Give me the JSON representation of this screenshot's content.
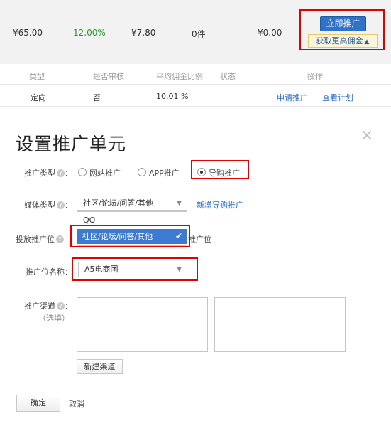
{
  "product_row": {
    "price": "¥65.00",
    "rate": "12.00%",
    "commission": "¥7.80",
    "count": "0件",
    "total": "¥0.00",
    "promote_button": "立即推广",
    "more_commission_button": "获取更高佣金"
  },
  "plan_table": {
    "headers": [
      "类型",
      "是否审核",
      "平均佣金比例",
      "状态",
      "操作"
    ],
    "row": {
      "type": "定向",
      "review": "否",
      "avg_rate": "10.01 %",
      "actions": [
        "申请推广",
        "查看计划"
      ]
    }
  },
  "dialog": {
    "title": "设置推广单元",
    "close_icon": "×",
    "promo_type": {
      "label": "推广类型",
      "options": [
        "网站推广",
        "APP推广",
        "导购推广"
      ],
      "selected": "导购推广"
    },
    "media_type": {
      "label": "媒体类型",
      "value": "社区/论坛/问答/其他",
      "new_link": "新增导购推广",
      "dropdown_options": [
        "QQ",
        "社区/论坛/问答/其他"
      ],
      "dropdown_selected": "社区/论坛/问答/其他"
    },
    "placement": {
      "label": "投放推广位",
      "partial_text": "推广位"
    },
    "placement_name": {
      "label": "推广位名称",
      "value": "A5电商团"
    },
    "channel": {
      "label": "推广渠道",
      "optional": "（选填）",
      "new_channel_button": "新建渠道"
    },
    "confirm_button": "确定",
    "cancel_link": "取消"
  },
  "colors": {
    "highlight_red": "#e00000",
    "primary_blue": "#2f72c7",
    "link_blue": "#2a6bc7",
    "rate_green": "#2a9a2a",
    "dropdown_selected_bg": "#3c7bd1"
  }
}
